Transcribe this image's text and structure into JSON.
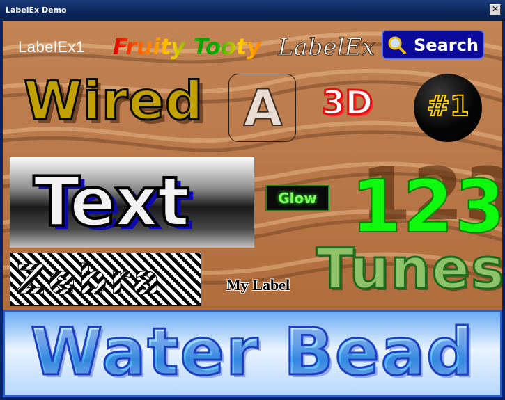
{
  "window": {
    "title": "LabelEx Demo",
    "close_glyph": "✕"
  },
  "labels": {
    "labelex1": "LabelEx1",
    "fruity": "Fruity Tooty",
    "script": "LabelEx",
    "search": "Search",
    "wired": "Wired",
    "a": "A",
    "three_d": "3D",
    "number_one": "#1",
    "text": "Text",
    "glow": "Glow",
    "digits": "123",
    "zebra": "Zebra",
    "my_label": "My Label",
    "tunes": "Tunes",
    "water_bead": "Water Bead"
  },
  "icons": {
    "search": "magnifier-icon",
    "close": "close-icon"
  },
  "colors": {
    "sand": "#b97a49",
    "glow_text": "#7dff5a",
    "digits": "#0ef90e",
    "three_d_stroke": "#e01010",
    "water_border": "#2c5dc8",
    "search_bg": "#0c0a9a"
  }
}
